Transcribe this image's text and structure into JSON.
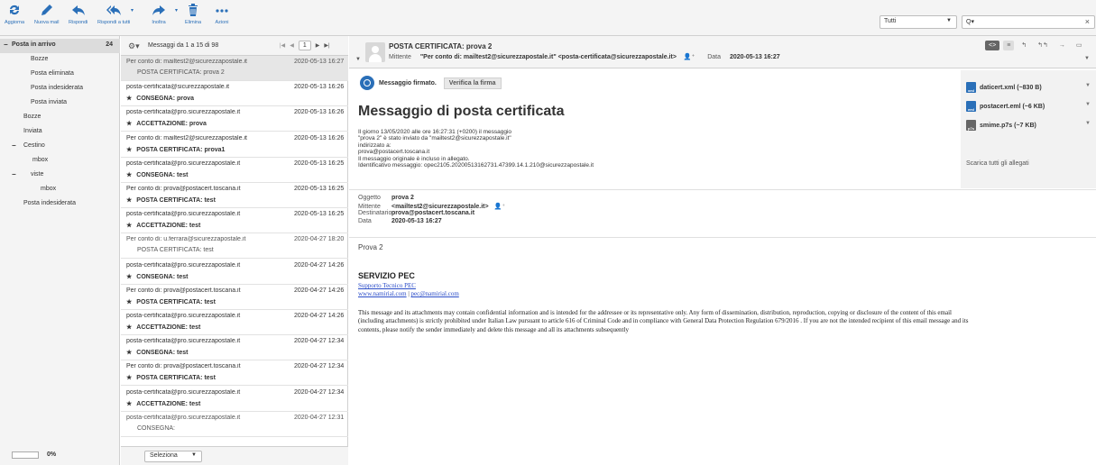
{
  "toolbar": {
    "buttons": [
      {
        "label": "Aggiorna"
      },
      {
        "label": "Nuova mail"
      },
      {
        "label": "Rispondi"
      },
      {
        "label": "Rispondi a tutti"
      },
      {
        "label": "Inoltra"
      },
      {
        "label": "Elimina"
      },
      {
        "label": "Azioni"
      }
    ],
    "filter": {
      "selected": "Tutti"
    },
    "search": {
      "placeholder": "Q▾"
    }
  },
  "folders": {
    "items": [
      {
        "label": "Posta in arrivo",
        "count": "24",
        "selected": true,
        "toggle": "−"
      },
      {
        "label": "Bozze"
      },
      {
        "label": "Posta eliminata"
      },
      {
        "label": "Posta indesiderata"
      },
      {
        "label": "Posta inviata"
      },
      {
        "label": "Bozze"
      },
      {
        "label": "Inviata"
      },
      {
        "label": "Cestino",
        "toggle": "−"
      },
      {
        "label": "mbox"
      },
      {
        "label": "viste",
        "toggle": "−"
      },
      {
        "label": "mbox"
      },
      {
        "label": "Posta indesiderata"
      }
    ],
    "quota": "0%"
  },
  "message_list": {
    "header": "Messaggi da 1 a 15 di 98",
    "page": "1",
    "select_label": "Seleziona",
    "messages": [
      {
        "from": "Per conto di: mailtest2@sicurezzapostale.it",
        "date": "2020-05-13 16:27",
        "subject": "POSTA CERTIFICATA: prova 2",
        "read": true,
        "selected": true
      },
      {
        "from": "posta-certificata@sicurezzapostale.it",
        "date": "2020-05-13 16:26",
        "subject": "CONSEGNA: prova",
        "read": false
      },
      {
        "from": "posta-certificata@pro.sicurezzapostale.it",
        "date": "2020-05-13 16:26",
        "subject": "ACCETTAZIONE: prova",
        "read": false
      },
      {
        "from": "Per conto di: mailtest2@sicurezzapostale.it",
        "date": "2020-05-13 16:26",
        "subject": "POSTA CERTIFICATA: prova1",
        "read": false
      },
      {
        "from": "posta-certificata@pro.sicurezzapostale.it",
        "date": "2020-05-13 16:25",
        "subject": "CONSEGNA: test",
        "read": false
      },
      {
        "from": "Per conto di: prova@postacert.toscana.it",
        "date": "2020-05-13 16:25",
        "subject": "POSTA CERTIFICATA: test",
        "read": false
      },
      {
        "from": "posta-certificata@pro.sicurezzapostale.it",
        "date": "2020-05-13 16:25",
        "subject": "ACCETTAZIONE: test",
        "read": false
      },
      {
        "from": "Per conto di: u.ferrara@sicurezzapostale.it",
        "date": "2020-04-27 18:20",
        "subject": "POSTA CERTIFICATA: test",
        "read": true
      },
      {
        "from": "posta-certificata@pro.sicurezzapostale.it",
        "date": "2020-04-27 14:26",
        "subject": "CONSEGNA: test",
        "read": false
      },
      {
        "from": "Per conto di: prova@postacert.toscana.it",
        "date": "2020-04-27 14:26",
        "subject": "POSTA CERTIFICATA: test",
        "read": false
      },
      {
        "from": "posta-certificata@pro.sicurezzapostale.it",
        "date": "2020-04-27 14:26",
        "subject": "ACCETTAZIONE: test",
        "read": false
      },
      {
        "from": "posta-certificata@pro.sicurezzapostale.it",
        "date": "2020-04-27 12:34",
        "subject": "CONSEGNA: test",
        "read": false
      },
      {
        "from": "Per conto di: prova@postacert.toscana.it",
        "date": "2020-04-27 12:34",
        "subject": "POSTA CERTIFICATA: test",
        "read": false
      },
      {
        "from": "posta-certificata@pro.sicurezzapostale.it",
        "date": "2020-04-27 12:34",
        "subject": "ACCETTAZIONE: test",
        "read": false
      },
      {
        "from": "posta-certificata@pro.sicurezzapostale.it",
        "date": "2020-04-27 12:31",
        "subject": "CONSEGNA:",
        "read": true
      }
    ]
  },
  "message": {
    "subject": "POSTA CERTIFICATA: prova 2",
    "sender_label": "Mittente",
    "sender": "\"Per conto di: mailtest2@sicurezzapostale.it\" <posta-certificata@sicurezzapostale.it>",
    "date_label": "Data",
    "date": "2020-05-13 16:27",
    "signed_label": "Messaggio firmato.",
    "verify_button": "Verifica la firma",
    "title": "Messaggio di posta certificata",
    "body_lines": [
      "Il giorno 13/05/2020 alle ore 16:27:31 (+0200) il messaggio",
      "\"prova 2\" è stato inviato da \"mailtest2@sicurezzapostale.it\"",
      "indirizzato a:",
      "prova@postacert.toscana.it",
      "Il messaggio originale è incluso in allegato.",
      "Identificativo messaggio: opec2105.20200513162731.47399.14.1.210@sicurezzapostale.it"
    ],
    "headers": [
      {
        "label": "Oggetto",
        "value": "prova 2"
      },
      {
        "label": "Mittente",
        "value": "<mailtest2@sicurezzapostale.it>"
      },
      {
        "label": "Destinatario",
        "value": "prova@postacert.toscana.it"
      },
      {
        "label": "Data",
        "value": "2020-05-13 16:27"
      }
    ],
    "content": "Prova 2",
    "signature": {
      "title": "SERVIZIO PEC",
      "link1": "Supporto Tecnico PEC",
      "link2": "www.namirial.com",
      "link_sep": "|",
      "link3": "pec@namirial.com"
    },
    "disclaimer": "This message and its attachments may contain confidential information and is intended for the addressee or its representative only. Any form of dissemination, distribution, reproduction, copying or disclosure of the content of this email (including attachments) is strictly prohibited under Italian Law pursuant to article 616 of Criminal Code and in compliance with General Data Protection Regulation 679/2016 . If you are not the intended recipient of this email message and its contents, please notify the sender immediately and delete this message and all its attachments subsequently"
  },
  "attachments": {
    "items": [
      {
        "name": "daticert.xml (~830 B)",
        "icon": "xml"
      },
      {
        "name": "postacert.eml (~6 KB)",
        "icon": "eml"
      },
      {
        "name": "smime.p7s (~7 KB)",
        "icon": "p7s"
      }
    ],
    "download_all": "Scarica tutti gli allegati"
  },
  "colors": {
    "accent": "#2a6fb8",
    "selected_row": "#e6e6e6",
    "panel": "#f4f4f4"
  }
}
